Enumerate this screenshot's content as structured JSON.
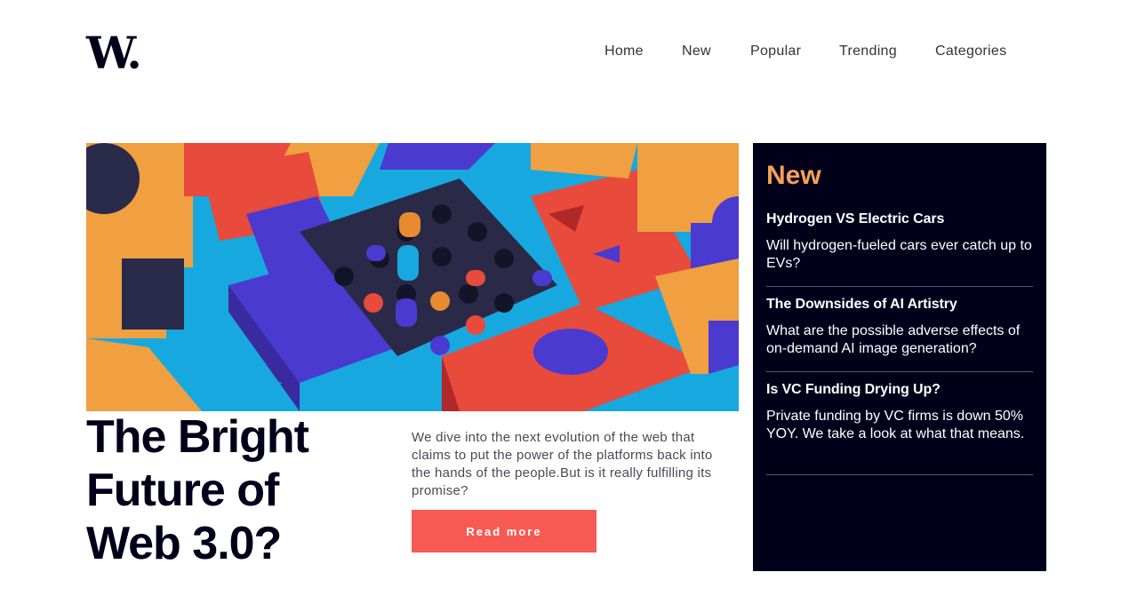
{
  "brand": {
    "logo_text": "W."
  },
  "nav": {
    "items": [
      {
        "label": "Home"
      },
      {
        "label": "New"
      },
      {
        "label": "Popular"
      },
      {
        "label": "Trending"
      },
      {
        "label": "Categories"
      }
    ]
  },
  "hero": {
    "title": "The Bright Future of Web 3.0?",
    "description": "We dive into the next evolution of the web that claims to put the power of the platforms back into the hands of the people.But is it really fulfilling its promise?",
    "cta_label": "Read more"
  },
  "sidebar": {
    "title": "New",
    "articles": [
      {
        "title": "Hydrogen VS Electric Cars",
        "summary": "Will hydrogen-fueled cars ever catch up to EVs?"
      },
      {
        "title": "The Downsides of AI Artistry",
        "summary": "What are the possible adverse effects of on-demand AI image generation?"
      },
      {
        "title": "Is VC Funding Drying Up?",
        "summary": "Private funding by VC firms is down 50% YOY. We take a look at what that means."
      }
    ]
  },
  "colors": {
    "dark_navy": "#00001a",
    "accent_red": "#f65a53",
    "accent_orange": "#f4a05a",
    "text_gray": "#4a4a58"
  }
}
